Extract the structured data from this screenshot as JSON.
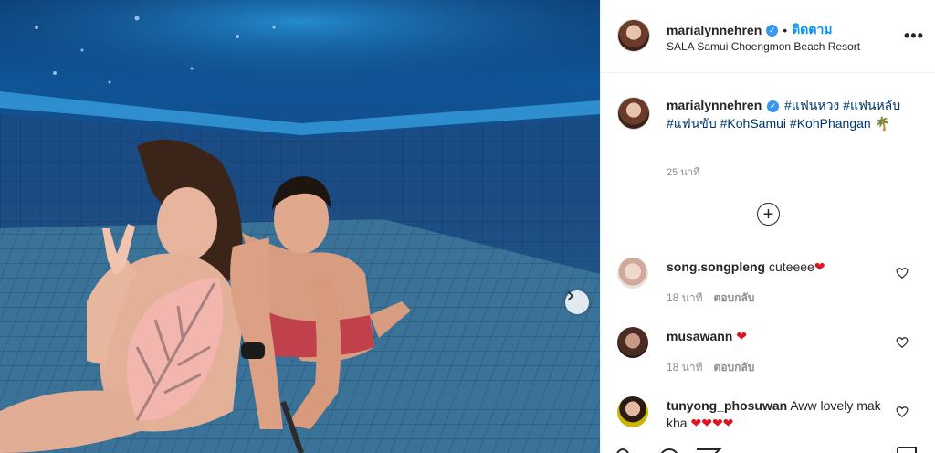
{
  "photo": {
    "alt": "",
    "next_icon": "chevron-right-icon"
  },
  "header": {
    "username": "marialynnehren",
    "verified_icon": "verified-badge-icon",
    "separator": "•",
    "follow_label": "ติดตาม",
    "location": "SALA Samui Choengmon Beach Resort",
    "more_icon": "more-options-icon",
    "more_glyph": "•••"
  },
  "caption": {
    "username": "marialynnehren",
    "tags": [
      "#แฟนหวง",
      "#แฟนหลับ",
      "#แฟนขับ",
      "#KohSamui",
      "#KohPhangan"
    ],
    "emoji": "🌴",
    "time": "25 นาที"
  },
  "load_more": {
    "glyph": "+"
  },
  "comments": [
    {
      "username": "song.songpleng",
      "text": "cuteeee",
      "hearts": 1,
      "time": "18 นาที",
      "reply_label": "ตอบกลับ"
    },
    {
      "username": "musawann",
      "text": "",
      "hearts": 1,
      "time": "18 นาที",
      "reply_label": "ตอบกลับ"
    },
    {
      "username": "tunyong_phosuwan",
      "text": "Aww lovely mak kha",
      "hearts": 4,
      "time": "",
      "reply_label": ""
    }
  ],
  "heart_glyph": "❤",
  "colors": {
    "link": "#00376b",
    "follow": "#0095f6",
    "verified": "#3897f0",
    "heart": "#e0141e"
  }
}
